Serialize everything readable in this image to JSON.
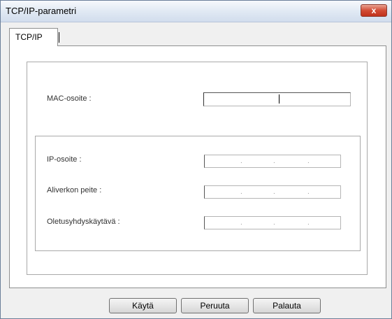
{
  "window": {
    "title": "TCP/IP-parametri",
    "close_label": "x"
  },
  "tabs": [
    {
      "label": "TCP/IP",
      "selected": true
    }
  ],
  "form": {
    "mac_label": "MAC-osoite :",
    "mac_value": "",
    "ip_label": "IP-osoite :",
    "subnet_label": "Aliverkon peite :",
    "gateway_label": "Oletusyhdyskäytävä :",
    "ip_separator": "."
  },
  "buttons": {
    "apply": "Käytä",
    "cancel": "Peruuta",
    "restore": "Palauta"
  },
  "colors": {
    "accent_close": "#c0311b",
    "dialog_background": "#f0f0f0"
  }
}
